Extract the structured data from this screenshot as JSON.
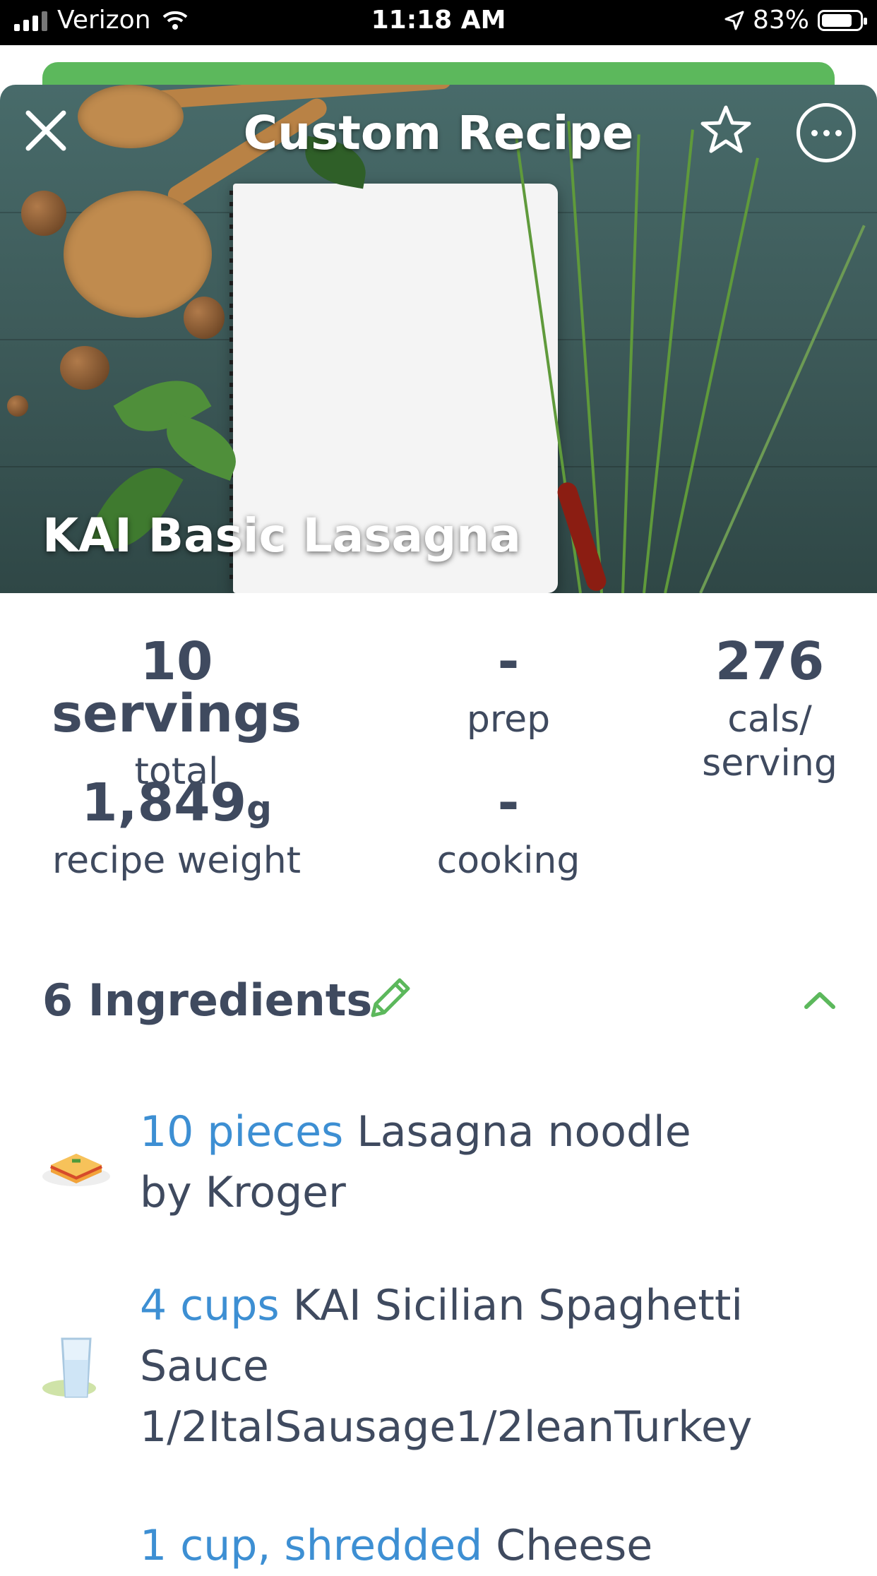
{
  "status_bar": {
    "carrier": "Verizon",
    "time": "11:18 AM",
    "battery": "83%",
    "battery_level": 0.83
  },
  "header": {
    "title": "Custom Recipe"
  },
  "recipe": {
    "name": "KAI Basic Lasagna"
  },
  "stats": {
    "servings_value": "10 servings",
    "servings_label": "total",
    "prep_value": "-",
    "prep_label": "prep",
    "cals_value": "276",
    "cals_label_1": "cals/",
    "cals_label_2": "serving",
    "weight_value": "1,849",
    "weight_unit": "g",
    "weight_label": "recipe weight",
    "cooking_value": "-",
    "cooking_label": "cooking"
  },
  "ingredients": {
    "header": "6 Ingredients",
    "items": [
      {
        "qty": "10 pieces",
        "name": "Lasagna noodle",
        "line2": "by Kroger",
        "icon": "lasagna-icon"
      },
      {
        "qty": "4 cups",
        "name": "KAI Sicilian Spaghetti",
        "line2": "Sauce",
        "line3": "1/2ItalSausage1/2leanTurkey",
        "icon": "glass-icon"
      },
      {
        "qty": "1 cup, shredded",
        "name": "Cheese",
        "icon": "cheese-icon"
      }
    ]
  },
  "colors": {
    "accent_green": "#5cb85c",
    "quantity_blue": "#3d8fd3",
    "text_dark": "#3f4a5f"
  }
}
